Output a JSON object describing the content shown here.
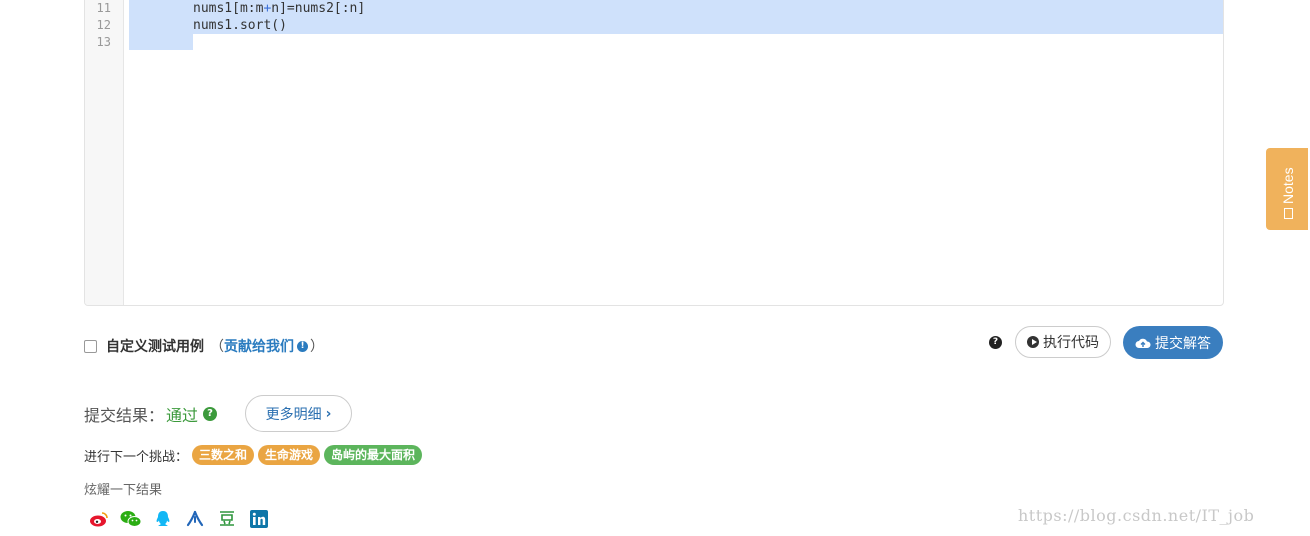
{
  "editor": {
    "line_numbers": [
      "11",
      "12",
      "13"
    ],
    "lines": [
      {
        "before": "nums1[m:m",
        "op": "+",
        "after": "n]=nums2[:n]"
      },
      {
        "text": "nums1.sort()"
      },
      {
        "text": ""
      }
    ]
  },
  "custom_test": {
    "label": "自定义测试用例",
    "paren_open": "（",
    "contribute_link": "贡献给我们",
    "paren_close": "）"
  },
  "actions": {
    "help_glyph": "?",
    "run_label": "执行代码",
    "submit_label": "提交解答"
  },
  "result": {
    "label": "提交结果：",
    "status": "通过",
    "help_glyph": "?",
    "more_label": "更多明细",
    "more_chevron": "›"
  },
  "next": {
    "label": "进行下一个挑战：",
    "tags": [
      {
        "label": "三数之和",
        "color": "#eaa542"
      },
      {
        "label": "生命游戏",
        "color": "#eaa542"
      },
      {
        "label": "岛屿的最大面积",
        "color": "#5cb55c"
      }
    ]
  },
  "brag": {
    "label": "炫耀一下结果"
  },
  "share_icons": [
    "weibo-icon",
    "wechat-icon",
    "qq-icon",
    "renren-icon",
    "douban-icon",
    "linkedin-icon"
  ],
  "notes": {
    "label": "Notes"
  },
  "watermark": "https://blog.csdn.net/IT_job",
  "colors": {
    "primary": "#3a7ebf",
    "success": "#3c9a3c",
    "notes_tab": "#f0b25c",
    "selection": "#cfe1fb"
  }
}
